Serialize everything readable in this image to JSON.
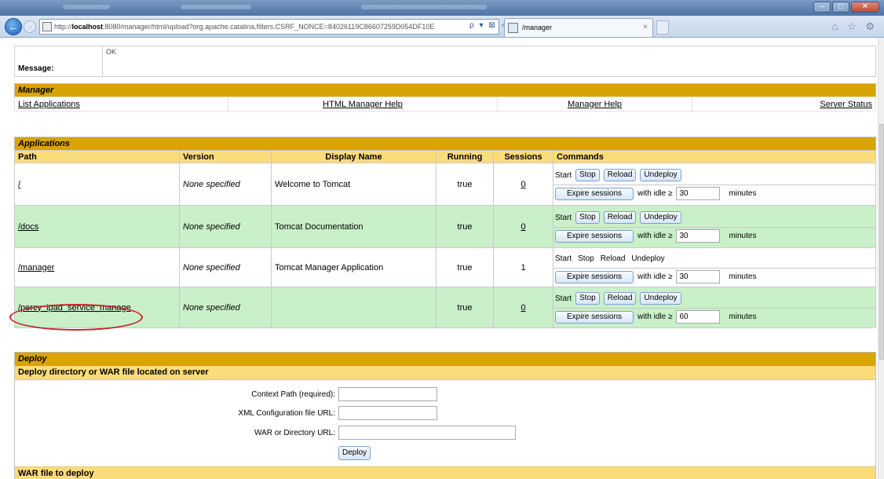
{
  "browser": {
    "address_prefix": "http://",
    "address_host": "localhost",
    "address_rest": ":8080/manager/html/upload?org.apache.catalina.filters.CSRF_NONCE=84026119C86607259D054DF10E",
    "addr_tools": "ρ ▾ ⊠ ♂ ✕",
    "tab_title": "/manager",
    "close_glyph": "×",
    "right_icons": "⌂ ☆ ⚙",
    "icons": [
      "back-arrow-icon",
      "forward-arrow-icon",
      "page-icon",
      "search-icon",
      "refresh-icon",
      "stop-icon",
      "home-icon",
      "star-icon",
      "gear-icon"
    ]
  },
  "message": {
    "label": "Message:",
    "value": "OK"
  },
  "manager": {
    "title": "Manager",
    "links": [
      "List Applications",
      "HTML Manager Help",
      "Manager Help",
      "Server Status"
    ]
  },
  "applications": {
    "title": "Applications",
    "headers": [
      "Path",
      "Version",
      "Display Name",
      "Running",
      "Sessions",
      "Commands"
    ],
    "rows": [
      {
        "path": "/",
        "version": "None specified",
        "display_name": "Welcome to Tomcat",
        "running": "true",
        "sessions": "0",
        "idle": "30"
      },
      {
        "path": "/docs",
        "version": "None specified",
        "display_name": "Tomcat Documentation",
        "running": "true",
        "sessions": "0",
        "idle": "30"
      },
      {
        "path": "/manager",
        "version": "None specified",
        "display_name": "Tomcat Manager Application",
        "running": "true",
        "sessions": "1",
        "idle": "30"
      },
      {
        "path": "/percy_ipad_service_manage",
        "version": "None specified",
        "display_name": "",
        "running": "true",
        "sessions": "0",
        "idle": "60"
      }
    ],
    "cmd": {
      "start": "Start",
      "stop": "Stop",
      "reload": "Reload",
      "undeploy": "Undeploy",
      "expire": "Expire sessions",
      "with_idle": "with idle ≥",
      "minutes": "minutes"
    }
  },
  "deploy": {
    "title": "Deploy",
    "subtitle": "Deploy directory or WAR file located on server",
    "context_label": "Context Path (required):",
    "xml_label": "XML Configuration file URL:",
    "war_label": "WAR or Directory URL:",
    "button": "Deploy",
    "war_section": "WAR file to deploy"
  },
  "colors": {
    "section": "#d8a400",
    "header": "#fbdc7b",
    "row_green": "#c9f0c9",
    "annotation": "#c8252a"
  }
}
